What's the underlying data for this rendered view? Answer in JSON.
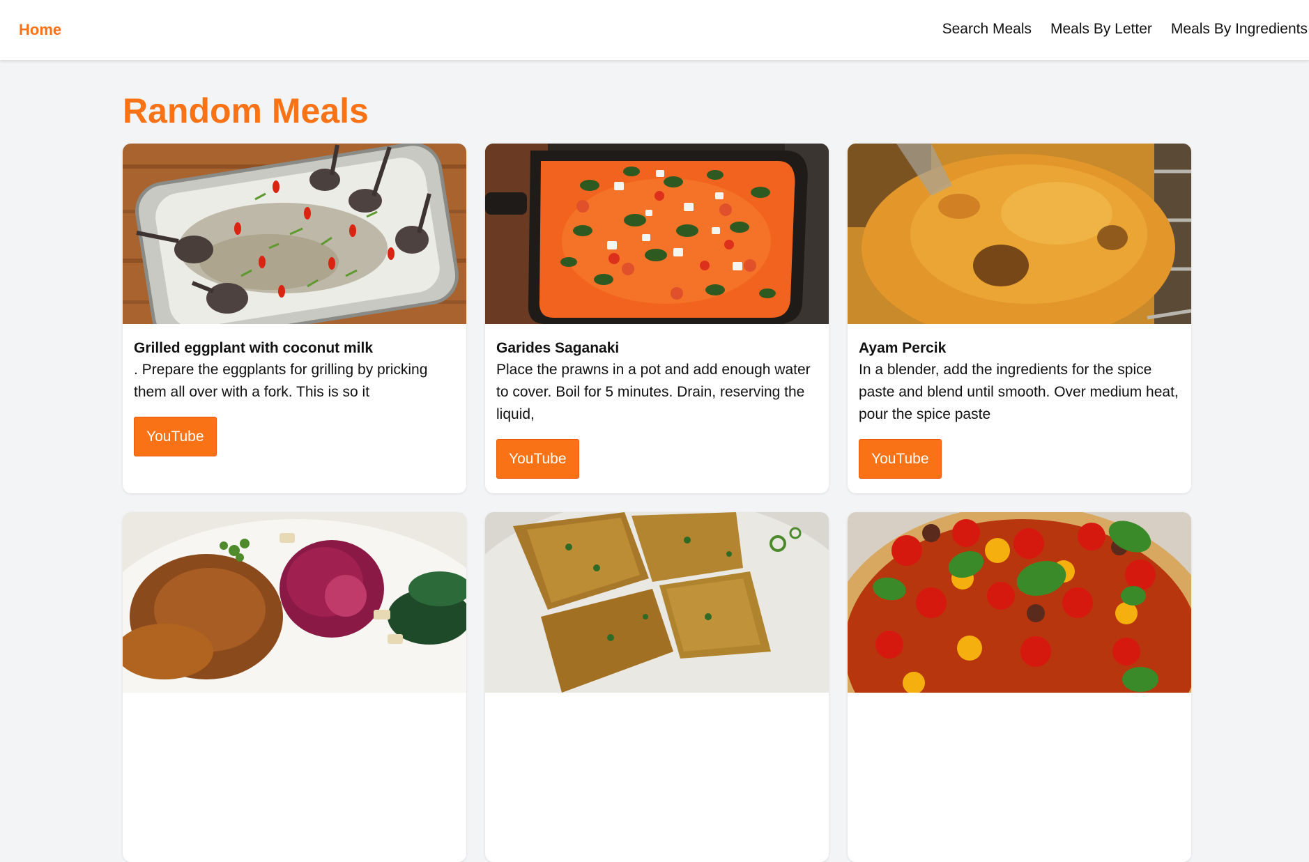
{
  "nav": {
    "home_label": "Home",
    "links": [
      "Search Meals",
      "Meals By Letter",
      "Meals By Ingredients"
    ]
  },
  "page_title": "Random Meals",
  "colors": {
    "accent": "#f97316",
    "background": "#f3f4f6"
  },
  "meals": [
    {
      "title": "Grilled eggplant with coconut milk",
      "description": ". Prepare the eggplants for grilling by pricking them all over with a fork. This is so it",
      "button_label": "YouTube",
      "image": "grilled-eggplant-photo"
    },
    {
      "title": "Garides Saganaki",
      "description": "Place the prawns in a pot and add enough water to cover. Boil for 5 minutes. Drain, reserving the liquid,",
      "button_label": "YouTube",
      "image": "garides-saganaki-photo"
    },
    {
      "title": "Ayam Percik",
      "description": "In a blender, add the ingredients for the spice paste and blend until smooth. Over medium heat, pour the spice paste",
      "button_label": "YouTube",
      "image": "ayam-percik-photo"
    },
    {
      "title": "",
      "description": "",
      "button_label": "",
      "image": "braised-meat-with-red-cabbage-photo"
    },
    {
      "title": "",
      "description": "",
      "button_label": "",
      "image": "egg-toast-slices-photo"
    },
    {
      "title": "",
      "description": "",
      "button_label": "",
      "image": "tomato-tart-photo"
    }
  ]
}
